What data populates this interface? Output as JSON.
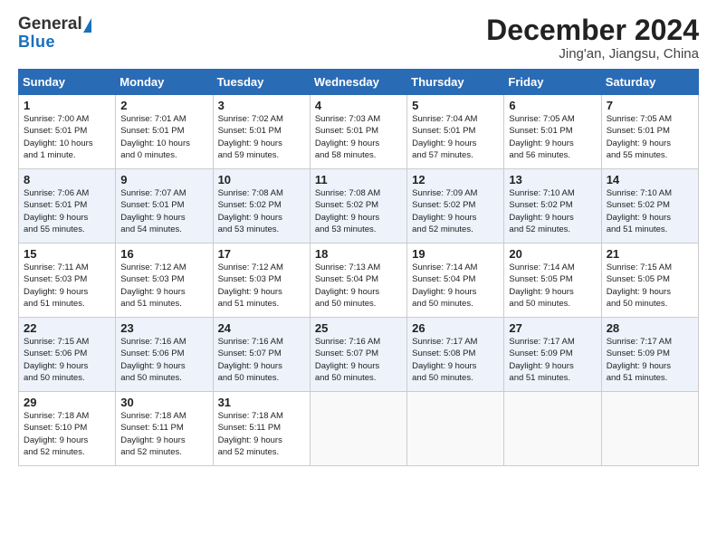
{
  "header": {
    "logo_general": "General",
    "logo_blue": "Blue",
    "title": "December 2024",
    "subtitle": "Jing'an, Jiangsu, China"
  },
  "weekdays": [
    "Sunday",
    "Monday",
    "Tuesday",
    "Wednesday",
    "Thursday",
    "Friday",
    "Saturday"
  ],
  "weeks": [
    [
      {
        "day": "1",
        "info": "Sunrise: 7:00 AM\nSunset: 5:01 PM\nDaylight: 10 hours\nand 1 minute."
      },
      {
        "day": "2",
        "info": "Sunrise: 7:01 AM\nSunset: 5:01 PM\nDaylight: 10 hours\nand 0 minutes."
      },
      {
        "day": "3",
        "info": "Sunrise: 7:02 AM\nSunset: 5:01 PM\nDaylight: 9 hours\nand 59 minutes."
      },
      {
        "day": "4",
        "info": "Sunrise: 7:03 AM\nSunset: 5:01 PM\nDaylight: 9 hours\nand 58 minutes."
      },
      {
        "day": "5",
        "info": "Sunrise: 7:04 AM\nSunset: 5:01 PM\nDaylight: 9 hours\nand 57 minutes."
      },
      {
        "day": "6",
        "info": "Sunrise: 7:05 AM\nSunset: 5:01 PM\nDaylight: 9 hours\nand 56 minutes."
      },
      {
        "day": "7",
        "info": "Sunrise: 7:05 AM\nSunset: 5:01 PM\nDaylight: 9 hours\nand 55 minutes."
      }
    ],
    [
      {
        "day": "8",
        "info": "Sunrise: 7:06 AM\nSunset: 5:01 PM\nDaylight: 9 hours\nand 55 minutes."
      },
      {
        "day": "9",
        "info": "Sunrise: 7:07 AM\nSunset: 5:01 PM\nDaylight: 9 hours\nand 54 minutes."
      },
      {
        "day": "10",
        "info": "Sunrise: 7:08 AM\nSunset: 5:02 PM\nDaylight: 9 hours\nand 53 minutes."
      },
      {
        "day": "11",
        "info": "Sunrise: 7:08 AM\nSunset: 5:02 PM\nDaylight: 9 hours\nand 53 minutes."
      },
      {
        "day": "12",
        "info": "Sunrise: 7:09 AM\nSunset: 5:02 PM\nDaylight: 9 hours\nand 52 minutes."
      },
      {
        "day": "13",
        "info": "Sunrise: 7:10 AM\nSunset: 5:02 PM\nDaylight: 9 hours\nand 52 minutes."
      },
      {
        "day": "14",
        "info": "Sunrise: 7:10 AM\nSunset: 5:02 PM\nDaylight: 9 hours\nand 51 minutes."
      }
    ],
    [
      {
        "day": "15",
        "info": "Sunrise: 7:11 AM\nSunset: 5:03 PM\nDaylight: 9 hours\nand 51 minutes."
      },
      {
        "day": "16",
        "info": "Sunrise: 7:12 AM\nSunset: 5:03 PM\nDaylight: 9 hours\nand 51 minutes."
      },
      {
        "day": "17",
        "info": "Sunrise: 7:12 AM\nSunset: 5:03 PM\nDaylight: 9 hours\nand 51 minutes."
      },
      {
        "day": "18",
        "info": "Sunrise: 7:13 AM\nSunset: 5:04 PM\nDaylight: 9 hours\nand 50 minutes."
      },
      {
        "day": "19",
        "info": "Sunrise: 7:14 AM\nSunset: 5:04 PM\nDaylight: 9 hours\nand 50 minutes."
      },
      {
        "day": "20",
        "info": "Sunrise: 7:14 AM\nSunset: 5:05 PM\nDaylight: 9 hours\nand 50 minutes."
      },
      {
        "day": "21",
        "info": "Sunrise: 7:15 AM\nSunset: 5:05 PM\nDaylight: 9 hours\nand 50 minutes."
      }
    ],
    [
      {
        "day": "22",
        "info": "Sunrise: 7:15 AM\nSunset: 5:06 PM\nDaylight: 9 hours\nand 50 minutes."
      },
      {
        "day": "23",
        "info": "Sunrise: 7:16 AM\nSunset: 5:06 PM\nDaylight: 9 hours\nand 50 minutes."
      },
      {
        "day": "24",
        "info": "Sunrise: 7:16 AM\nSunset: 5:07 PM\nDaylight: 9 hours\nand 50 minutes."
      },
      {
        "day": "25",
        "info": "Sunrise: 7:16 AM\nSunset: 5:07 PM\nDaylight: 9 hours\nand 50 minutes."
      },
      {
        "day": "26",
        "info": "Sunrise: 7:17 AM\nSunset: 5:08 PM\nDaylight: 9 hours\nand 50 minutes."
      },
      {
        "day": "27",
        "info": "Sunrise: 7:17 AM\nSunset: 5:09 PM\nDaylight: 9 hours\nand 51 minutes."
      },
      {
        "day": "28",
        "info": "Sunrise: 7:17 AM\nSunset: 5:09 PM\nDaylight: 9 hours\nand 51 minutes."
      }
    ],
    [
      {
        "day": "29",
        "info": "Sunrise: 7:18 AM\nSunset: 5:10 PM\nDaylight: 9 hours\nand 52 minutes."
      },
      {
        "day": "30",
        "info": "Sunrise: 7:18 AM\nSunset: 5:11 PM\nDaylight: 9 hours\nand 52 minutes."
      },
      {
        "day": "31",
        "info": "Sunrise: 7:18 AM\nSunset: 5:11 PM\nDaylight: 9 hours\nand 52 minutes."
      },
      {
        "day": "",
        "info": ""
      },
      {
        "day": "",
        "info": ""
      },
      {
        "day": "",
        "info": ""
      },
      {
        "day": "",
        "info": ""
      }
    ]
  ]
}
